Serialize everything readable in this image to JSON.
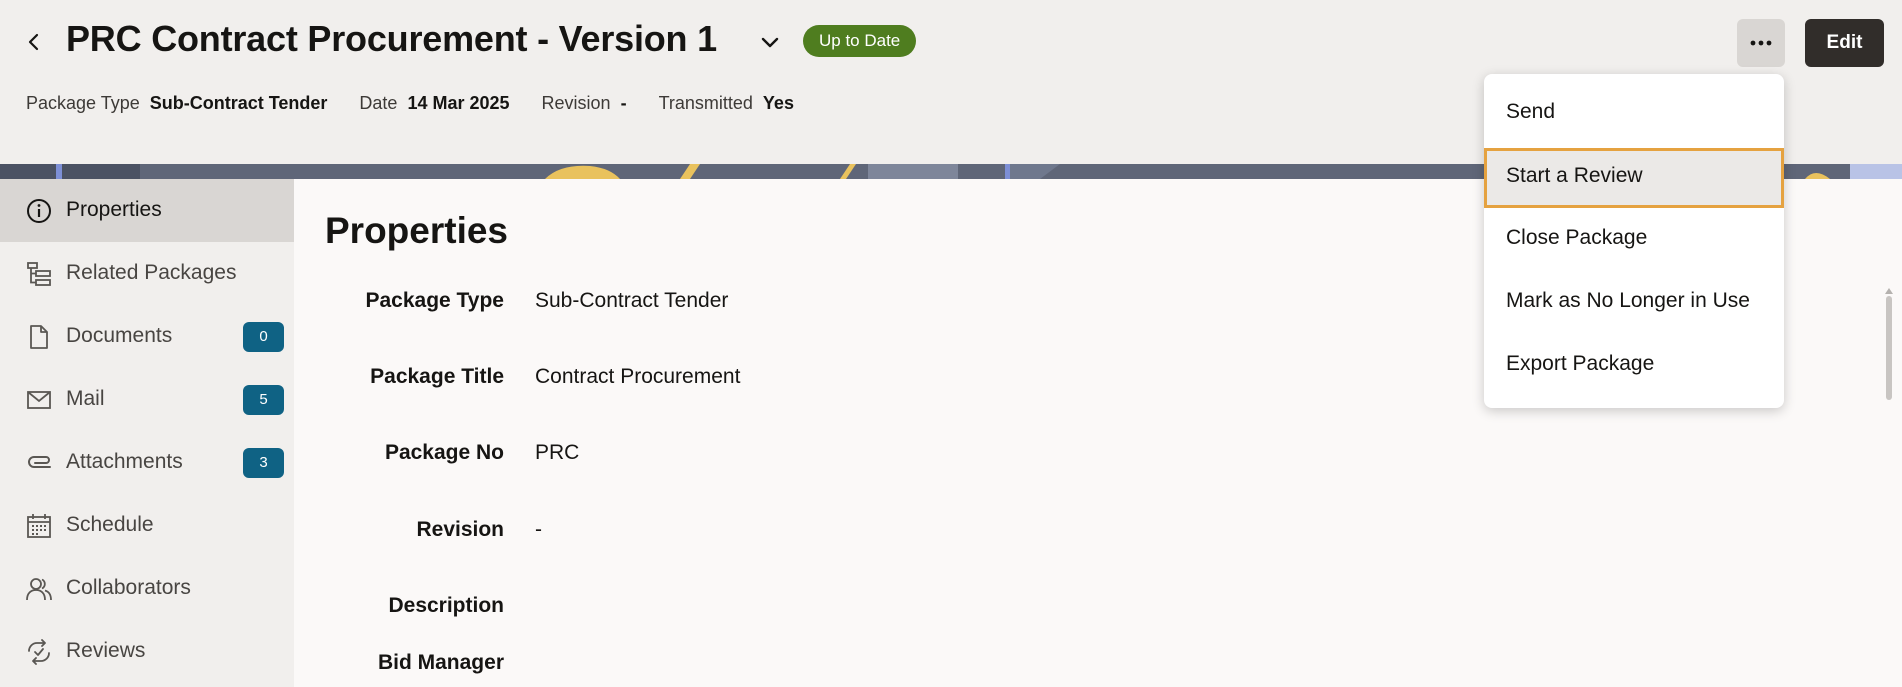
{
  "header": {
    "title": "PRC Contract Procurement - Version 1",
    "status_badge": "Up to Date",
    "edit_label": "Edit",
    "meta": [
      {
        "label": "Package Type",
        "value": "Sub-Contract Tender"
      },
      {
        "label": "Date",
        "value": "14 Mar 2025"
      },
      {
        "label": "Revision",
        "value": "-"
      },
      {
        "label": "Transmitted",
        "value": "Yes"
      }
    ]
  },
  "sidebar": {
    "items": [
      {
        "label": "Properties",
        "icon": "info-icon",
        "active": true
      },
      {
        "label": "Related Packages",
        "icon": "hierarchy-icon"
      },
      {
        "label": "Documents",
        "icon": "document-icon",
        "count": "0"
      },
      {
        "label": "Mail",
        "icon": "mail-icon",
        "count": "5"
      },
      {
        "label": "Attachments",
        "icon": "paperclip-icon",
        "count": "3"
      },
      {
        "label": "Schedule",
        "icon": "calendar-icon"
      },
      {
        "label": "Collaborators",
        "icon": "people-icon"
      },
      {
        "label": "Reviews",
        "icon": "review-icon"
      }
    ]
  },
  "main": {
    "title": "Properties",
    "fields": [
      {
        "label": "Package Type",
        "value": "Sub-Contract Tender"
      },
      {
        "label": "Package Title",
        "value": "Contract Procurement"
      },
      {
        "label": "Package No",
        "value": "PRC"
      },
      {
        "label": "Revision",
        "value": "-"
      },
      {
        "label": "Description",
        "value": ""
      },
      {
        "label": "Bid Manager",
        "value": ""
      }
    ]
  },
  "menu": {
    "items": [
      {
        "label": "Send"
      },
      {
        "label": "Start a Review",
        "focused": true
      },
      {
        "label": "Close Package"
      },
      {
        "label": "Mark as No Longer in Use"
      },
      {
        "label": "Export Package"
      }
    ]
  },
  "colors": {
    "status_badge": "#4f7d1f",
    "count_badge": "#0f6284",
    "edit_button": "#312d2a",
    "focus_outline": "#e5a240"
  }
}
